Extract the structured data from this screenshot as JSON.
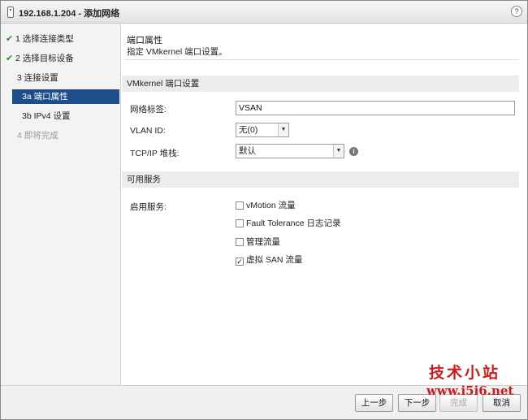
{
  "window": {
    "title": "192.168.1.204 - 添加网络",
    "help": "?"
  },
  "sidebar": {
    "steps": [
      {
        "check": "✔",
        "label": "1 选择连接类型"
      },
      {
        "check": "✔",
        "label": "2 选择目标设备"
      },
      {
        "label": "3 连接设置"
      },
      {
        "label": "3a 端口属性"
      },
      {
        "label": "3b IPv4 设置"
      },
      {
        "label": "4 即将完成"
      }
    ]
  },
  "main": {
    "section_title": "端口属性",
    "section_desc": "指定 VMkernel 端口设置。",
    "vmk_group": "VMkernel 端口设置",
    "fields": {
      "network_label_label": "网络标签:",
      "network_label_value": "VSAN",
      "vlan_label": "VLAN ID:",
      "vlan_value": "无(0)",
      "tcpip_label": "TCP/IP 堆栈:",
      "tcpip_value": "默认"
    },
    "services_group": "可用服务",
    "services_label": "启用服务:",
    "services": [
      {
        "label": "vMotion 流量",
        "checked": false
      },
      {
        "label": "Fault Tolerance 日志记录",
        "checked": false
      },
      {
        "label": "管理流量",
        "checked": false
      },
      {
        "label": "虚拟 SAN 流量",
        "checked": true,
        "mark": "✓"
      }
    ]
  },
  "footer": {
    "back": "上一步",
    "next": "下一步",
    "finish": "完成",
    "cancel": "取消"
  },
  "watermark": {
    "title": "技术小站",
    "url": "www.i5i6.net"
  },
  "icons": {
    "dropdown": "▼",
    "info": "i"
  },
  "colors": {
    "active_step": "#1d4e8a",
    "check": "#2e8b2e",
    "watermark": "#d01a1a"
  }
}
